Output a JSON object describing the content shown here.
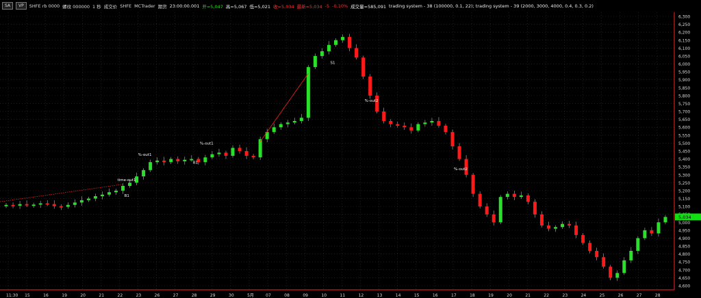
{
  "header": {
    "toolbar_buttons": [
      "SA",
      "VP"
    ],
    "symbol": "SHFE rb 0000",
    "extra_items": [
      "螺纹 000000",
      "1 秒",
      "成交价",
      "SHFE",
      "MCTrader",
      "期货"
    ],
    "time": "23:00:00.001",
    "open": "开=5,047",
    "high": "高=5,067",
    "low": "低=5,021",
    "close": "收=5,034",
    "last": "最新=5,034",
    "change": "-5",
    "change_pct": "-0.10%",
    "volume": "成交量=585,091",
    "strategies": "trading system - 38 (100000, 0.1, 22); trading system - 39 (2000, 3000, 4000, 0.4, 0.3, 0.2)"
  },
  "colors": {
    "up": "#2be02b",
    "down": "#ff1a1a",
    "price_tag": "#10e010",
    "grid": "#333333",
    "trendline": "#ff2020",
    "axis": "#ff2020"
  },
  "price_axis": [
    "6,300",
    "6,250",
    "6,200",
    "6,150",
    "6,100",
    "6,050",
    "6,000",
    "5,950",
    "5,900",
    "5,850",
    "5,800",
    "5,750",
    "5,700",
    "5,650",
    "5,600",
    "5,550",
    "5,500",
    "5,450",
    "5,400",
    "5,350",
    "5,300",
    "5,250",
    "5,200",
    "5,150",
    "5,100",
    "5,050",
    "5,000",
    "4,950",
    "4,900",
    "4,850",
    "4,800",
    "4,750",
    "4,700",
    "4,650",
    "4,600"
  ],
  "last_price_tag": "5,034",
  "date_axis": [
    "11:30",
    "15",
    "16",
    "19",
    "20",
    "21",
    "22",
    "23",
    "26",
    "27",
    "28",
    "29",
    "30",
    "5月",
    "07",
    "08",
    "09",
    "10",
    "11",
    "12",
    "13",
    "14",
    "15",
    "16",
    "17",
    "18",
    "19",
    "20",
    "21",
    "22",
    "23",
    "24",
    "25",
    "26",
    "27",
    "28"
  ],
  "annotations": [
    "time-out1",
    "B1",
    "%-out1",
    "B1",
    "%-out1",
    "S1",
    "%-out2",
    "%-out2"
  ],
  "chart_data": {
    "type": "candlestick",
    "y_range": [
      4600,
      6300
    ],
    "series": [
      {
        "name": "trading system - 38",
        "values": []
      }
    ],
    "close_path": [
      5110,
      5105,
      5115,
      5108,
      5112,
      5120,
      5115,
      5102,
      5098,
      5110,
      5125,
      5140,
      5150,
      5165,
      5175,
      5190,
      5200,
      5230,
      5250,
      5290,
      5330,
      5380,
      5390,
      5380,
      5400,
      5385,
      5395,
      5400,
      5380,
      5410,
      5430,
      5440,
      5420,
      5470,
      5450,
      5420,
      5410,
      5525,
      5570,
      5600,
      5620,
      5630,
      5640,
      5660,
      5980,
      6050,
      6080,
      6120,
      6150,
      6170,
      6100,
      6040,
      5920,
      5800,
      5700,
      5640,
      5620,
      5610,
      5600,
      5580,
      5620,
      5630,
      5640,
      5610,
      5570,
      5480,
      5400,
      5300,
      5180,
      5100,
      5050,
      5000,
      5160,
      5180,
      5160,
      5170,
      5130,
      5050,
      4980,
      4960,
      4970,
      4990,
      4980,
      4920,
      4870,
      4820,
      4780,
      4720,
      4650,
      4680,
      4760,
      4820,
      4900,
      4950,
      4930,
      5000,
      5034
    ]
  }
}
